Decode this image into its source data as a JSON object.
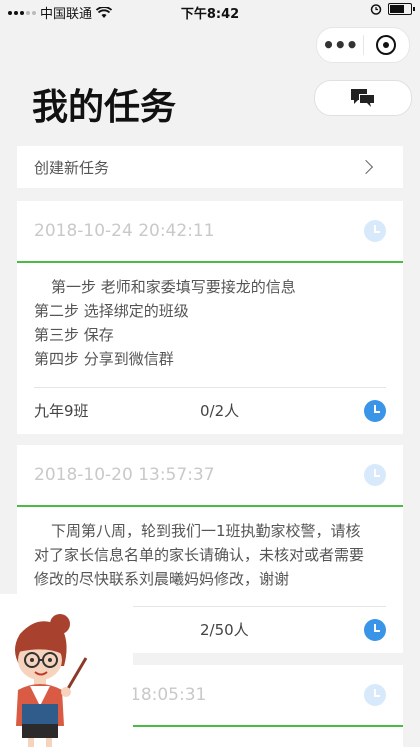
{
  "status_bar": {
    "carrier": "中国联通",
    "time": "下午8:42"
  },
  "capsule": {
    "more_label": "•••"
  },
  "page": {
    "title": "我的任务"
  },
  "create_task": {
    "label": "创建新任务"
  },
  "colors": {
    "accent_green": "#4cba46",
    "clock_blue": "#3a94e8",
    "clock_light": "#d7e9fb"
  },
  "tasks": [
    {
      "time": "2018-10-24 20:42:11",
      "lines": [
        "第一步 老师和家委填写要接龙的信息",
        "第二步 选择绑定的班级",
        "第三步 保存",
        "第四步 分享到微信群"
      ],
      "class_name": "九年9班",
      "count": "0/2人"
    },
    {
      "time": "2018-10-20 13:57:37",
      "lines": [
        "下周第八周，轮到我们一1班执勤家校警，请核",
        "对了家长信息名单的家长请确认，未核对或者需要",
        "修改的尽快联系刘晨曦妈妈修改，谢谢"
      ],
      "class_name": "",
      "count": "2/50人"
    },
    {
      "time": "18:05:31",
      "lines": []
    }
  ]
}
